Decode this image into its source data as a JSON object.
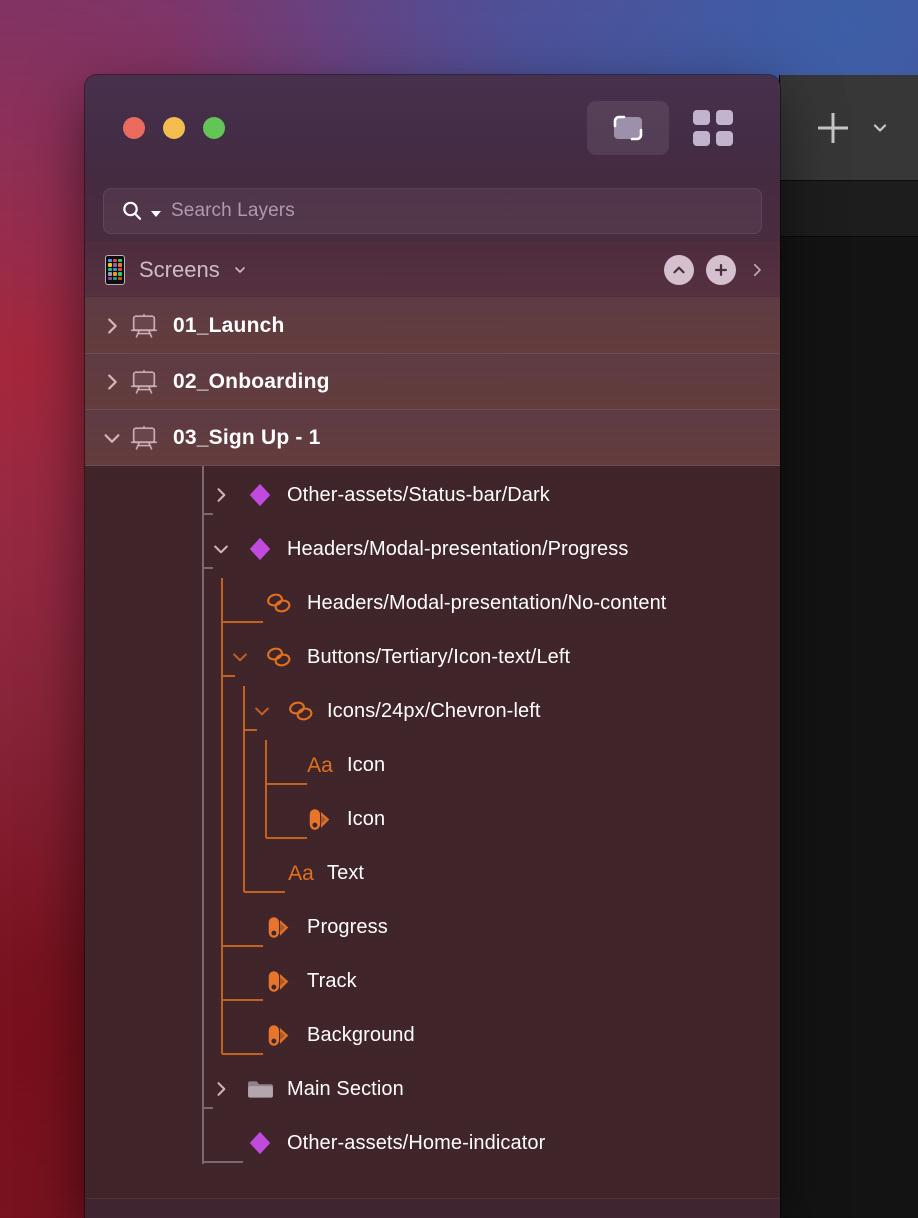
{
  "window": {
    "traffic_lights": [
      {
        "name": "close",
        "color": "#ec6a5e"
      },
      {
        "name": "minimize",
        "color": "#f4bd4f"
      },
      {
        "name": "zoom",
        "color": "#61c554"
      }
    ],
    "view_toggles": [
      {
        "name": "canvas-view",
        "label": "Canvas view",
        "selected": true
      },
      {
        "name": "grid-view",
        "label": "Grid view",
        "selected": false
      }
    ]
  },
  "search": {
    "placeholder": "Search Layers",
    "value": "",
    "icon": "search-icon"
  },
  "page_header": {
    "icon": "phone-icon",
    "title": "Screens",
    "chevron": "chevron-down-icon",
    "actions": [
      {
        "name": "collapse-all-button",
        "icon": "chevron-up-icon"
      },
      {
        "name": "add-artboard-button",
        "icon": "plus-icon"
      },
      {
        "name": "next-page-button",
        "icon": "chevron-right-icon"
      }
    ]
  },
  "artboards": [
    {
      "name": "01_Launch",
      "icon": "artboard-icon",
      "expanded": false,
      "twisty": "chevron-right-icon"
    },
    {
      "name": "02_Onboarding",
      "icon": "artboard-icon",
      "expanded": false,
      "twisty": "chevron-right-icon"
    },
    {
      "name": "03_Sign Up - 1",
      "icon": "artboard-icon",
      "expanded": true,
      "twisty": "chevron-down-icon"
    }
  ],
  "layers": [
    {
      "label": "Other-assets/Status-bar/Dark",
      "icon": "symbol-diamond-icon",
      "depth": 1,
      "twisty": "chevron-right-icon",
      "expanded": false
    },
    {
      "label": "Headers/Modal-presentation/Progress",
      "icon": "symbol-diamond-icon",
      "depth": 1,
      "twisty": "chevron-down-icon",
      "expanded": true
    },
    {
      "label": "Headers/Modal-presentation/No-content",
      "icon": "symbol-instance-icon",
      "depth": 2,
      "twisty": null,
      "expanded": false
    },
    {
      "label": "Buttons/Tertiary/Icon-text/Left",
      "icon": "symbol-instance-icon",
      "depth": 2,
      "twisty": "chevron-down-icon",
      "expanded": true
    },
    {
      "label": "Icons/24px/Chevron-left",
      "icon": "symbol-instance-icon",
      "depth": 3,
      "twisty": "chevron-down-icon",
      "expanded": true
    },
    {
      "label": "Icon",
      "icon": "text-layer-icon",
      "depth": 4,
      "twisty": null,
      "expanded": false
    },
    {
      "label": "Icon",
      "icon": "shape-layer-icon",
      "depth": 4,
      "twisty": null,
      "expanded": false
    },
    {
      "label": "Text",
      "icon": "text-layer-icon",
      "depth": 3,
      "twisty": null,
      "expanded": false
    },
    {
      "label": "Progress",
      "icon": "shape-layer-icon",
      "depth": 2,
      "twisty": null,
      "expanded": false
    },
    {
      "label": "Track",
      "icon": "shape-layer-icon",
      "depth": 2,
      "twisty": null,
      "expanded": false
    },
    {
      "label": "Background",
      "icon": "shape-layer-icon",
      "depth": 2,
      "twisty": null,
      "expanded": false
    },
    {
      "label": "Main Section",
      "icon": "folder-icon",
      "depth": 1,
      "twisty": "chevron-right-icon",
      "expanded": false
    },
    {
      "label": "Other-assets/Home-indicator",
      "icon": "symbol-diamond-icon",
      "depth": 1,
      "twisty": null,
      "expanded": false
    }
  ],
  "background_window": {
    "toolbar": [
      {
        "name": "add-button",
        "icon": "plus-icon"
      },
      {
        "name": "add-options-button",
        "icon": "chevron-down-icon"
      }
    ]
  },
  "colors": {
    "symbol_purple": "#c14ae0",
    "instance_orange": "#e0701f",
    "shape_orange": "#e8752a",
    "folder_gray": "#a79aa0",
    "row_text": "#ffffff",
    "panel_bg": "#3f2329",
    "artboard_row_bg": "#5f3c40",
    "titlebar_bg": "#452c46"
  },
  "phone_icon_cells": [
    "#4a9df0",
    "#e84c3d",
    "#2fcc70",
    "#f2c511",
    "#9b59b6",
    "#e67e22",
    "#1abc9c",
    "#3498db",
    "#e74c3c",
    "#95a5a6",
    "#f39c12",
    "#2ecc71",
    "#8e44ad",
    "#16a085",
    "#d35400"
  ]
}
